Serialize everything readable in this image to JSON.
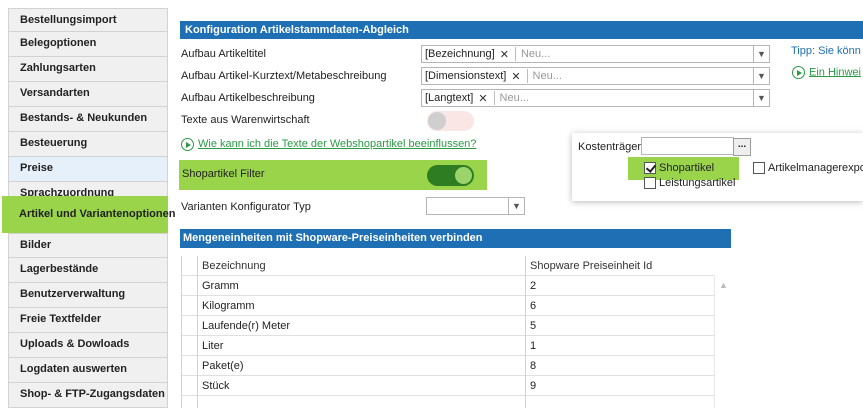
{
  "sidebar": {
    "items": [
      {
        "label": "Bestellungsimport"
      },
      {
        "label": "Belegoptionen"
      },
      {
        "label": "Zahlungsarten"
      },
      {
        "label": "Versandarten"
      },
      {
        "label": "Bestands- & Neukunden"
      },
      {
        "label": "Besteuerung"
      },
      {
        "label": "Preise"
      },
      {
        "label": "Sprachzuordnung"
      },
      {
        "label": "Artikel und Variantenoptionen"
      },
      {
        "label": "Bilder"
      },
      {
        "label": "Lagerbestände"
      },
      {
        "label": "Benutzerverwaltung"
      },
      {
        "label": "Freie Textfelder"
      },
      {
        "label": "Uploads & Dowloads"
      },
      {
        "label": "Logdaten auswerten"
      },
      {
        "label": "Shop- & FTP-Zugangsdaten"
      }
    ],
    "active": "Artikel und Variantenoptionen",
    "highlight_color": "#99d44a"
  },
  "main": {
    "section_title": "Konfiguration Artikelstammdaten-Abgleich",
    "fields": {
      "artikeltitel": {
        "label": "Aufbau Artikeltitel",
        "tag": "[Bezeichnung]",
        "placeholder": "Neu..."
      },
      "kurztext": {
        "label": "Aufbau Artikel-Kurztext/Metabeschreibung",
        "tag": "[Dimensionstext]",
        "placeholder": "Neu..."
      },
      "beschreibung": {
        "label": "Aufbau Artikelbeschreibung",
        "tag": "[Langtext]",
        "placeholder": "Neu..."
      }
    },
    "texte_warenwirtschaft": {
      "label": "Texte aus Warenwirtschaft",
      "enabled": false
    },
    "help_link": "Wie kann ich die Texte der Webshopartikel beeinflussen?",
    "shopartikel_filter": {
      "label": "Shopartikel Filter",
      "enabled": true
    },
    "varianten_konfigurator": {
      "label": "Varianten Konfigurator Typ",
      "value": ""
    },
    "tip": "Tipp: Sie könn",
    "hint_link": "Ein Hinwei"
  },
  "popup": {
    "kostentraeger_label": "Kostenträger",
    "browse_button": "...",
    "shopartikel": {
      "label": "Shopartikel",
      "checked": true
    },
    "leistungsartikel": {
      "label": "Leistungsartikel",
      "checked": false
    },
    "artikelmanager": {
      "label": "Artikelmanagerexpor",
      "checked": false
    }
  },
  "table": {
    "title": "Mengeneinheiten mit Shopware-Preiseinheiten verbinden",
    "columns": [
      "Bezeichnung",
      "Shopware Preiseinheit Id"
    ],
    "rows": [
      [
        "Gramm",
        "2"
      ],
      [
        "Kilogramm",
        "6"
      ],
      [
        "Laufende(r) Meter",
        "5"
      ],
      [
        "Liter",
        "1"
      ],
      [
        "Paket(e)",
        "8"
      ],
      [
        "Stück",
        "9"
      ]
    ]
  },
  "colors": {
    "accent_blue": "#1e6fb4",
    "link_green": "#2a9a45",
    "toggle_on": "#2e7d23",
    "highlight": "#99d44a"
  }
}
